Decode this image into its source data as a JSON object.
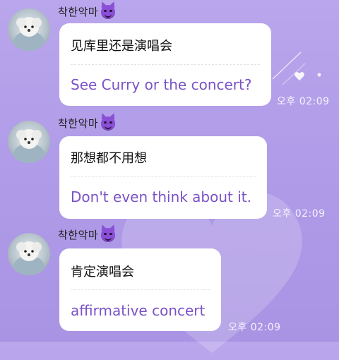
{
  "chat": {
    "messages": [
      {
        "sender": "착한악마",
        "original": "见库里还是演唱会",
        "translation": "See Curry or the concert?",
        "time": "오후 02:09"
      },
      {
        "sender": "착한악마",
        "original": "那想都不用想",
        "translation": "Don't even think about it.",
        "time": "오후 02:09"
      },
      {
        "sender": "착한악마",
        "original": "肯定演唱会",
        "translation": "affirmative concert",
        "time": "오후 02:09"
      }
    ]
  },
  "colors": {
    "background": "#b09ce8",
    "bubble": "#ffffff",
    "translation_text": "#7a52c7",
    "timestamp": "#f4f2ff"
  },
  "icons": [
    "devil-emoji-icon",
    "avatar-photo"
  ]
}
